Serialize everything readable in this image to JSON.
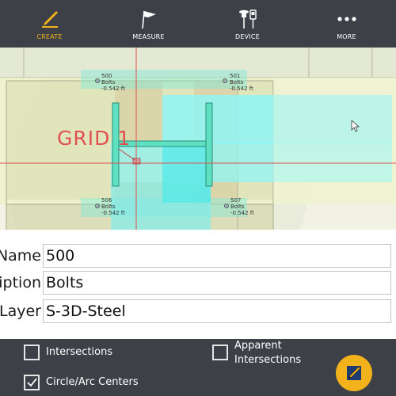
{
  "toolbar": {
    "tabs": [
      {
        "label": "CREATE",
        "icon": "pencil-icon",
        "active": true
      },
      {
        "label": "MEASURE",
        "icon": "flag-icon",
        "active": false
      },
      {
        "label": "DEVICE",
        "icon": "device-icon",
        "active": false
      },
      {
        "label": "MORE",
        "icon": "ellipsis-icon",
        "active": false
      }
    ]
  },
  "map": {
    "grid_label": "GRID 1",
    "points": [
      {
        "id": "500",
        "name": "Bolts",
        "value": "-0.542 ft"
      },
      {
        "id": "501",
        "name": "Bolts",
        "value": "-0.542 ft"
      },
      {
        "id": "506",
        "name": "Bolts",
        "value": "-0.542 ft"
      },
      {
        "id": "507",
        "name": "Bolts",
        "value": "-0.542 ft"
      }
    ]
  },
  "form": {
    "name": {
      "label": "Name",
      "value": "500"
    },
    "description": {
      "label": "Description",
      "value": "Bolts"
    },
    "layer": {
      "label": "Layer",
      "value": "S-3D-Steel"
    }
  },
  "snap": {
    "intersections": {
      "label": "Intersections",
      "checked": false
    },
    "apparent": {
      "label_line1": "Apparent",
      "label_line2": "Intersections",
      "checked": false
    },
    "circle_arc": {
      "label": "Circle/Arc Centers",
      "checked": true
    }
  },
  "colors": {
    "accent": "#f2b21b",
    "toolbar": "#3d4047",
    "grid_line": "#e05050",
    "steel": "#4fe3c8",
    "cyan_area": "#8ff5f5"
  }
}
